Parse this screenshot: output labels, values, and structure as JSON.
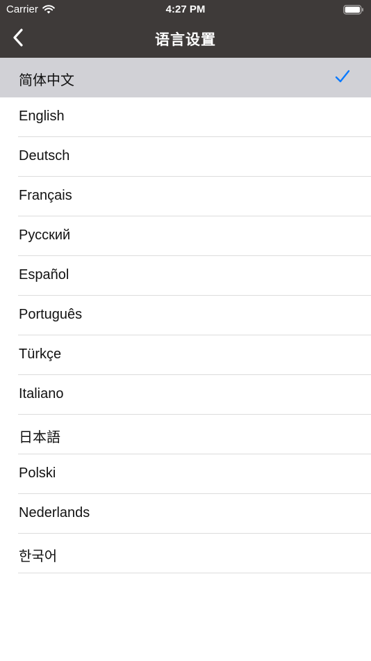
{
  "status_bar": {
    "carrier": "Carrier",
    "time": "4:27 PM",
    "icons": [
      "wifi-icon",
      "battery-icon"
    ]
  },
  "nav": {
    "back_icon": "chevron-left-icon",
    "title": "语言设置"
  },
  "languages": [
    {
      "label": "简体中文",
      "selected": true
    },
    {
      "label": "English",
      "selected": false
    },
    {
      "label": "Deutsch",
      "selected": false
    },
    {
      "label": "Français",
      "selected": false
    },
    {
      "label": "Русский",
      "selected": false
    },
    {
      "label": "Español",
      "selected": false
    },
    {
      "label": "Português",
      "selected": false
    },
    {
      "label": "Türkçe",
      "selected": false
    },
    {
      "label": "Italiano",
      "selected": false
    },
    {
      "label": "日本語",
      "selected": false
    },
    {
      "label": "Polski",
      "selected": false
    },
    {
      "label": "Nederlands",
      "selected": false
    },
    {
      "label": "한국어",
      "selected": false
    }
  ],
  "selected_marker_icon": "checkmark-icon",
  "colors": {
    "nav_background": "#3e3a39",
    "selected_row_background": "#d1d1d6",
    "accent": "#0a7aff"
  }
}
